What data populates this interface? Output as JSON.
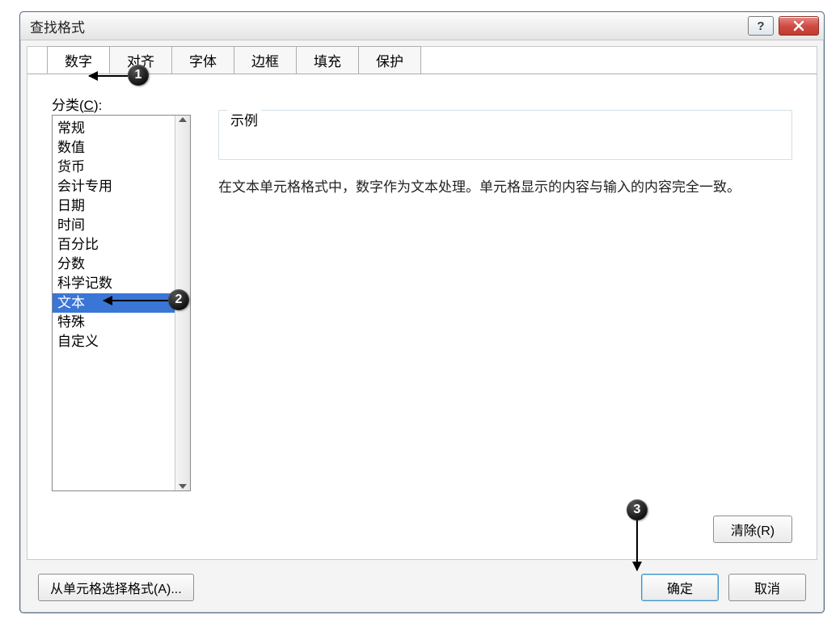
{
  "title": "查找格式",
  "tabs": {
    "number": "数字",
    "alignment": "对齐",
    "font": "字体",
    "border": "边框",
    "fill": "填充",
    "protection": "保护"
  },
  "categoryLabel": "分类(C):",
  "categories": {
    "general": "常规",
    "number": "数值",
    "currency": "货币",
    "accounting": "会计专用",
    "date": "日期",
    "time": "时间",
    "percent": "百分比",
    "fraction": "分数",
    "scientific": "科学记数",
    "text": "文本",
    "special": "特殊",
    "custom": "自定义"
  },
  "exampleLabel": "示例",
  "description": "在文本单元格格式中，数字作为文本处理。单元格显示的内容与输入的内容完全一致。",
  "buttons": {
    "clear": "清除(R)",
    "fromCell": "从单元格选择格式(A)...",
    "ok": "确定",
    "cancel": "取消",
    "help": "?"
  },
  "callouts": {
    "one": "1",
    "two": "2",
    "three": "3"
  }
}
